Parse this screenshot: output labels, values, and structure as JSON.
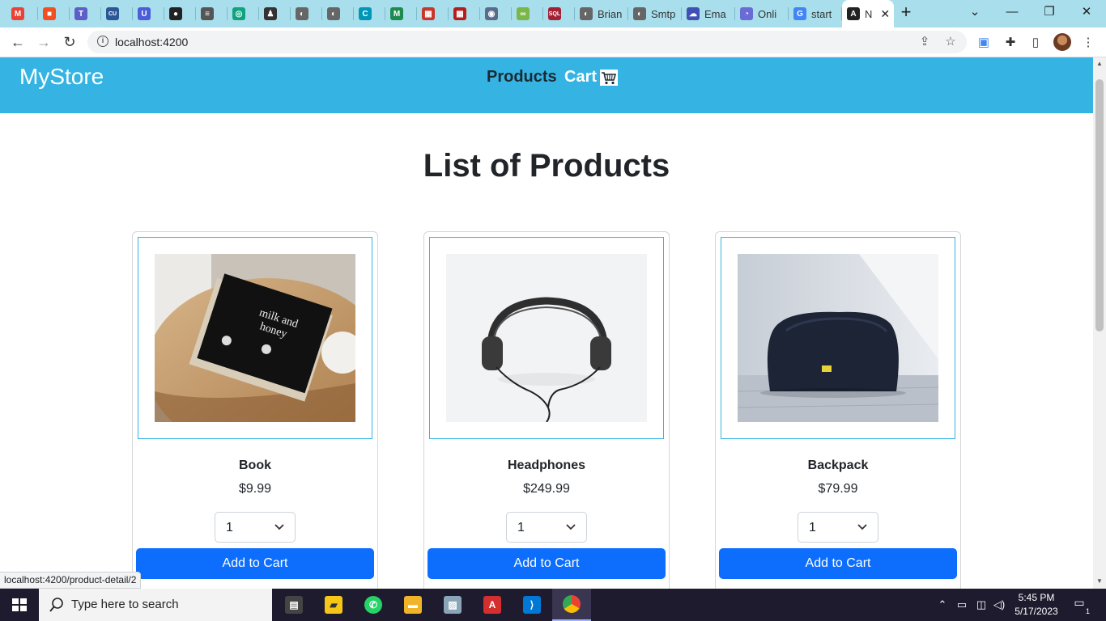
{
  "browser": {
    "tabs": [
      {
        "label": "",
        "icon": "gmail-icon",
        "color": "#ea4335",
        "glyph": "M"
      },
      {
        "label": "",
        "icon": "microsoft-icon",
        "color": "#f25022",
        "glyph": "■"
      },
      {
        "label": "",
        "icon": "teams-icon",
        "color": "#5b5fc7",
        "glyph": "T"
      },
      {
        "label": "",
        "icon": "site-icon",
        "color": "#2b5797",
        "glyph": "CU"
      },
      {
        "label": "",
        "icon": "udemy-icon",
        "color": "#4b5dd8",
        "glyph": "U"
      },
      {
        "label": "",
        "icon": "github-icon",
        "color": "#222222",
        "glyph": "●"
      },
      {
        "label": "",
        "icon": "site-icon",
        "color": "#555555",
        "glyph": "≡"
      },
      {
        "label": "",
        "icon": "chatgpt-icon",
        "color": "#10a37f",
        "glyph": "◎"
      },
      {
        "label": "",
        "icon": "profile-icon",
        "color": "#333333",
        "glyph": "♟"
      },
      {
        "label": "",
        "icon": "globe-icon",
        "color": "#666666",
        "glyph": "◐"
      },
      {
        "label": "",
        "icon": "globe-icon",
        "color": "#666666",
        "glyph": "◐"
      },
      {
        "label": "",
        "icon": "site-icon",
        "color": "#0096b7",
        "glyph": "C"
      },
      {
        "label": "",
        "icon": "site-icon",
        "color": "#1d8b4e",
        "glyph": "M"
      },
      {
        "label": "",
        "icon": "site-icon",
        "color": "#c9372c",
        "glyph": "▦"
      },
      {
        "label": "",
        "icon": "site-icon",
        "color": "#b71c1c",
        "glyph": "▦"
      },
      {
        "label": "",
        "icon": "site-icon",
        "color": "#5a6b8c",
        "glyph": "◉"
      },
      {
        "label": "",
        "icon": "site-icon",
        "color": "#7ab648",
        "glyph": "∞"
      },
      {
        "label": "",
        "icon": "sql-icon",
        "color": "#a31f34",
        "glyph": "SQL"
      },
      {
        "label": "Brian",
        "icon": "globe-icon",
        "color": "#666666",
        "glyph": "◐"
      },
      {
        "label": "Smtp",
        "icon": "globe-icon",
        "color": "#666666",
        "glyph": "◐"
      },
      {
        "label": "Ema",
        "icon": "cloud-icon",
        "color": "#3f51b5",
        "glyph": "☁"
      },
      {
        "label": "Onli",
        "icon": "site-icon",
        "color": "#6b6bd6",
        "glyph": "◔"
      },
      {
        "label": "start",
        "icon": "google-icon",
        "color": "#4285f4",
        "glyph": "G"
      },
      {
        "label": "N",
        "icon": "angular-icon",
        "color": "#222222",
        "glyph": "A",
        "active": true
      }
    ],
    "url": "localhost:4200",
    "status_url": "localhost:4200/product-detail/2"
  },
  "site": {
    "brand": "MyStore",
    "nav": {
      "products": "Products",
      "cart": "Cart"
    },
    "page_title": "List of Products",
    "products": [
      {
        "name": "Book",
        "price": "$9.99",
        "qty": "1",
        "button": "Add to Cart"
      },
      {
        "name": "Headphones",
        "price": "$249.99",
        "qty": "1",
        "button": "Add to Cart"
      },
      {
        "name": "Backpack",
        "price": "$79.99",
        "qty": "1",
        "button": "Add to Cart"
      }
    ],
    "colors": {
      "header": "#35b4e3",
      "button": "#0d6efd"
    }
  },
  "taskbar": {
    "search_placeholder": "Type here to search",
    "time": "5:45 PM",
    "date": "5/17/2023",
    "notification_count": "1"
  }
}
